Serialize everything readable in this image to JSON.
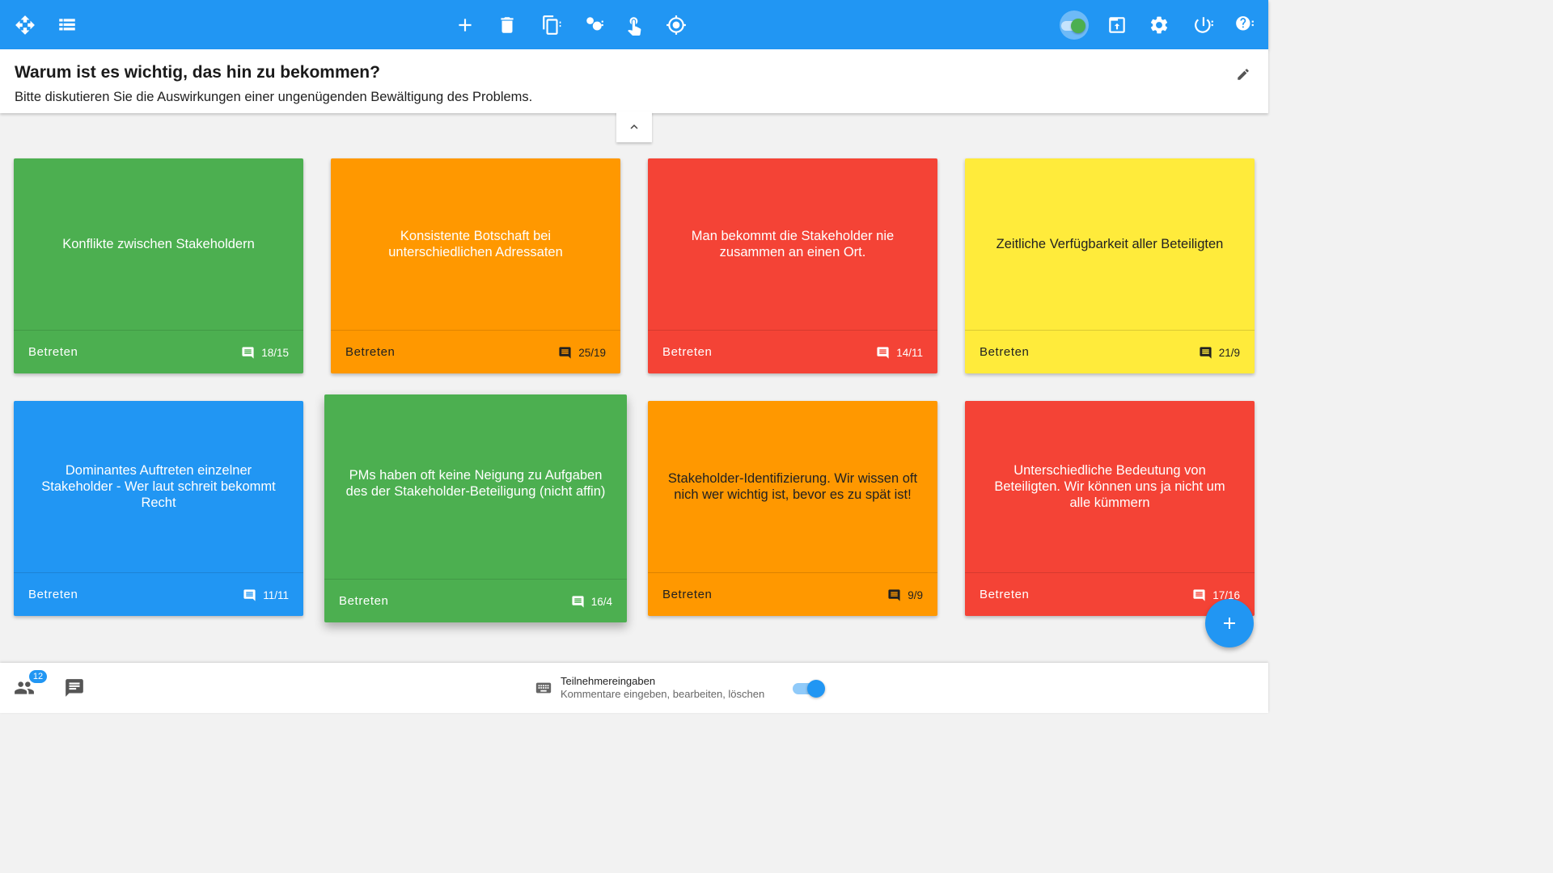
{
  "colors": {
    "primary": "#2196f3",
    "green": "#4caf50",
    "orange": "#ff9800",
    "red": "#f44336",
    "yellow": "#ffeb3b",
    "blue": "#2196f3"
  },
  "toolbar": {
    "left_icons": [
      "move-icon",
      "list-view-icon"
    ],
    "center_icons": [
      "add-icon",
      "delete-icon",
      "copy-icon",
      "group-icon",
      "touch-icon",
      "target-icon"
    ],
    "right_icons": [
      "toggle-switch",
      "export-icon",
      "settings-icon",
      "power-icon",
      "help-icon"
    ]
  },
  "question": {
    "title": "Warum ist es wichtig, das hin zu bekommen?",
    "subtitle": "Bitte diskutieren Sie die Auswirkungen einer ungenügenden Bewältigung des Problems."
  },
  "cards": [
    {
      "text": "Konflikte zwischen Stakeholdern",
      "enter": "Betreten",
      "count": "18/15",
      "color": "#4caf50"
    },
    {
      "text": "Konsistente Botschaft bei unterschiedlichen Adressaten",
      "enter": "Betreten",
      "count": "25/19",
      "color": "#ff9800"
    },
    {
      "text": "Man bekommt die Stakeholder nie zusammen an einen Ort.",
      "enter": "Betreten",
      "count": "14/11",
      "color": "#f44336"
    },
    {
      "text": "Zeitliche Verfügbarkeit aller Beteiligten",
      "enter": "Betreten",
      "count": "21/9",
      "color": "#ffeb3b"
    },
    {
      "text": "Dominantes Auftreten einzelner Stakeholder - Wer laut schreit bekommt Recht",
      "enter": "Betreten",
      "count": "11/11",
      "color": "#2196f3"
    },
    {
      "text": "PMs haben oft keine Neigung zu Aufgaben des der Stakeholder-Beteiligung (nicht affin)",
      "enter": "Betreten",
      "count": "16/4",
      "color": "#4caf50"
    },
    {
      "text": "Stakeholder-Identifizierung. Wir wissen oft nich wer wichtig ist, bevor es zu spät ist!",
      "enter": "Betreten",
      "count": "9/9",
      "color": "#ff9800"
    },
    {
      "text": "Unterschiedliche Bedeutung von Beteiligten. Wir können uns ja nicht um alle kümmern",
      "enter": "Betreten",
      "count": "17/16",
      "color": "#f44336"
    }
  ],
  "bottom": {
    "participants_badge": "12",
    "input_label": "Teilnehmereingaben",
    "input_sub": "Kommentare eingeben, bearbeiten, löschen"
  }
}
